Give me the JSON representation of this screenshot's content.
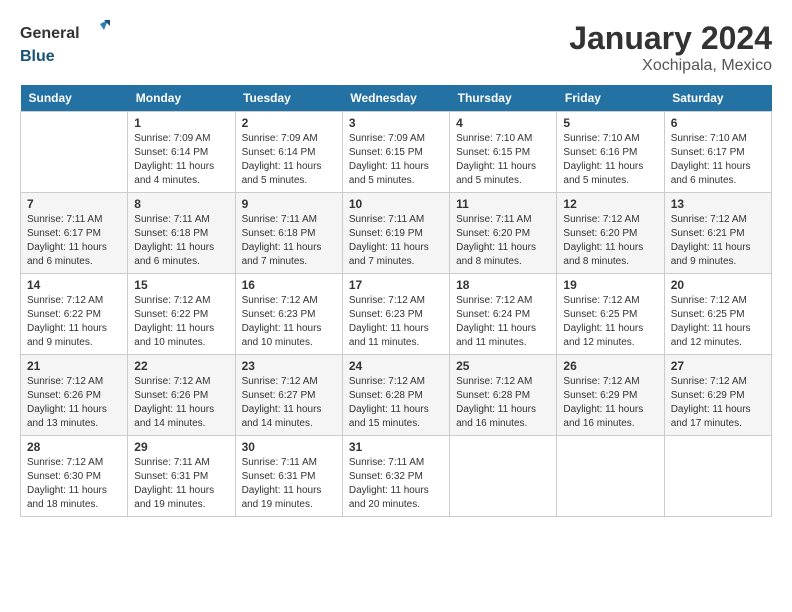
{
  "header": {
    "logo_general": "General",
    "logo_blue": "Blue",
    "month_year": "January 2024",
    "location": "Xochipala, Mexico"
  },
  "days_of_week": [
    "Sunday",
    "Monday",
    "Tuesday",
    "Wednesday",
    "Thursday",
    "Friday",
    "Saturday"
  ],
  "weeks": [
    [
      {
        "day": "",
        "info": ""
      },
      {
        "day": "1",
        "info": "Sunrise: 7:09 AM\nSunset: 6:14 PM\nDaylight: 11 hours\nand 4 minutes."
      },
      {
        "day": "2",
        "info": "Sunrise: 7:09 AM\nSunset: 6:14 PM\nDaylight: 11 hours\nand 5 minutes."
      },
      {
        "day": "3",
        "info": "Sunrise: 7:09 AM\nSunset: 6:15 PM\nDaylight: 11 hours\nand 5 minutes."
      },
      {
        "day": "4",
        "info": "Sunrise: 7:10 AM\nSunset: 6:15 PM\nDaylight: 11 hours\nand 5 minutes."
      },
      {
        "day": "5",
        "info": "Sunrise: 7:10 AM\nSunset: 6:16 PM\nDaylight: 11 hours\nand 5 minutes."
      },
      {
        "day": "6",
        "info": "Sunrise: 7:10 AM\nSunset: 6:17 PM\nDaylight: 11 hours\nand 6 minutes."
      }
    ],
    [
      {
        "day": "7",
        "info": "Sunrise: 7:11 AM\nSunset: 6:17 PM\nDaylight: 11 hours\nand 6 minutes."
      },
      {
        "day": "8",
        "info": "Sunrise: 7:11 AM\nSunset: 6:18 PM\nDaylight: 11 hours\nand 6 minutes."
      },
      {
        "day": "9",
        "info": "Sunrise: 7:11 AM\nSunset: 6:18 PM\nDaylight: 11 hours\nand 7 minutes."
      },
      {
        "day": "10",
        "info": "Sunrise: 7:11 AM\nSunset: 6:19 PM\nDaylight: 11 hours\nand 7 minutes."
      },
      {
        "day": "11",
        "info": "Sunrise: 7:11 AM\nSunset: 6:20 PM\nDaylight: 11 hours\nand 8 minutes."
      },
      {
        "day": "12",
        "info": "Sunrise: 7:12 AM\nSunset: 6:20 PM\nDaylight: 11 hours\nand 8 minutes."
      },
      {
        "day": "13",
        "info": "Sunrise: 7:12 AM\nSunset: 6:21 PM\nDaylight: 11 hours\nand 9 minutes."
      }
    ],
    [
      {
        "day": "14",
        "info": "Sunrise: 7:12 AM\nSunset: 6:22 PM\nDaylight: 11 hours\nand 9 minutes."
      },
      {
        "day": "15",
        "info": "Sunrise: 7:12 AM\nSunset: 6:22 PM\nDaylight: 11 hours\nand 10 minutes."
      },
      {
        "day": "16",
        "info": "Sunrise: 7:12 AM\nSunset: 6:23 PM\nDaylight: 11 hours\nand 10 minutes."
      },
      {
        "day": "17",
        "info": "Sunrise: 7:12 AM\nSunset: 6:23 PM\nDaylight: 11 hours\nand 11 minutes."
      },
      {
        "day": "18",
        "info": "Sunrise: 7:12 AM\nSunset: 6:24 PM\nDaylight: 11 hours\nand 11 minutes."
      },
      {
        "day": "19",
        "info": "Sunrise: 7:12 AM\nSunset: 6:25 PM\nDaylight: 11 hours\nand 12 minutes."
      },
      {
        "day": "20",
        "info": "Sunrise: 7:12 AM\nSunset: 6:25 PM\nDaylight: 11 hours\nand 12 minutes."
      }
    ],
    [
      {
        "day": "21",
        "info": "Sunrise: 7:12 AM\nSunset: 6:26 PM\nDaylight: 11 hours\nand 13 minutes."
      },
      {
        "day": "22",
        "info": "Sunrise: 7:12 AM\nSunset: 6:26 PM\nDaylight: 11 hours\nand 14 minutes."
      },
      {
        "day": "23",
        "info": "Sunrise: 7:12 AM\nSunset: 6:27 PM\nDaylight: 11 hours\nand 14 minutes."
      },
      {
        "day": "24",
        "info": "Sunrise: 7:12 AM\nSunset: 6:28 PM\nDaylight: 11 hours\nand 15 minutes."
      },
      {
        "day": "25",
        "info": "Sunrise: 7:12 AM\nSunset: 6:28 PM\nDaylight: 11 hours\nand 16 minutes."
      },
      {
        "day": "26",
        "info": "Sunrise: 7:12 AM\nSunset: 6:29 PM\nDaylight: 11 hours\nand 16 minutes."
      },
      {
        "day": "27",
        "info": "Sunrise: 7:12 AM\nSunset: 6:29 PM\nDaylight: 11 hours\nand 17 minutes."
      }
    ],
    [
      {
        "day": "28",
        "info": "Sunrise: 7:12 AM\nSunset: 6:30 PM\nDaylight: 11 hours\nand 18 minutes."
      },
      {
        "day": "29",
        "info": "Sunrise: 7:11 AM\nSunset: 6:31 PM\nDaylight: 11 hours\nand 19 minutes."
      },
      {
        "day": "30",
        "info": "Sunrise: 7:11 AM\nSunset: 6:31 PM\nDaylight: 11 hours\nand 19 minutes."
      },
      {
        "day": "31",
        "info": "Sunrise: 7:11 AM\nSunset: 6:32 PM\nDaylight: 11 hours\nand 20 minutes."
      },
      {
        "day": "",
        "info": ""
      },
      {
        "day": "",
        "info": ""
      },
      {
        "day": "",
        "info": ""
      }
    ]
  ]
}
